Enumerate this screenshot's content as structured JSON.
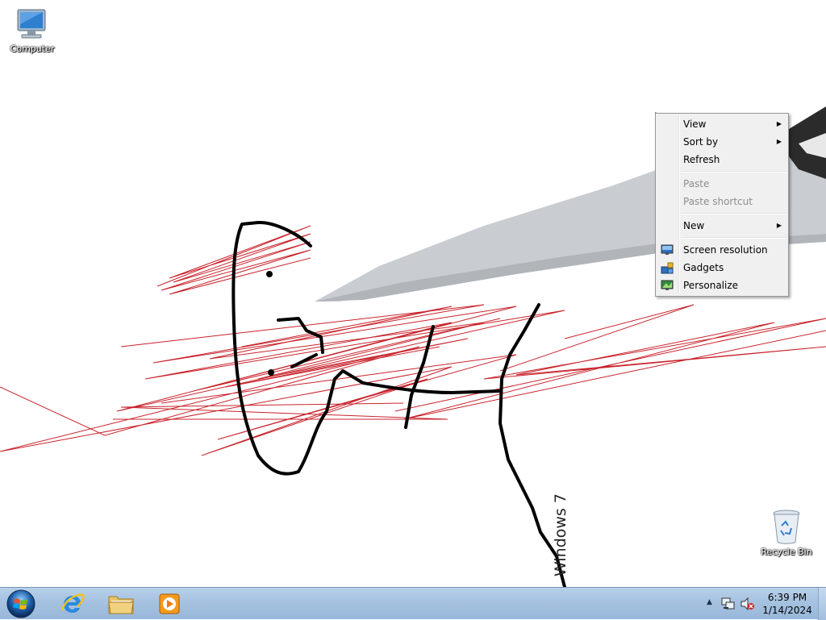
{
  "desktop": {
    "icons": [
      {
        "label": "Computer",
        "icon": "computer-icon"
      },
      {
        "label": "Recycle Bin",
        "icon": "recycle-bin-icon"
      }
    ],
    "wallpaper_text": "Windows 7"
  },
  "context_menu": {
    "items": [
      {
        "label": "View",
        "submenu": true,
        "enabled": true
      },
      {
        "label": "Sort by",
        "submenu": true,
        "enabled": true
      },
      {
        "label": "Refresh",
        "submenu": false,
        "enabled": true
      },
      {
        "label": "Paste",
        "submenu": false,
        "enabled": false
      },
      {
        "label": "Paste shortcut",
        "submenu": false,
        "enabled": false
      },
      {
        "label": "New",
        "submenu": true,
        "enabled": true
      },
      {
        "label": "Screen resolution",
        "icon": "screen-resolution-icon",
        "enabled": true
      },
      {
        "label": "Gadgets",
        "icon": "gadgets-icon",
        "enabled": true
      },
      {
        "label": "Personalize",
        "icon": "personalize-icon",
        "enabled": true
      }
    ],
    "submenu_arrow": "▶"
  },
  "taskbar": {
    "pinned": [
      {
        "icon": "start-orb-icon"
      },
      {
        "icon": "internet-explorer-icon"
      },
      {
        "icon": "file-explorer-icon"
      },
      {
        "icon": "media-player-icon"
      }
    ],
    "tray": {
      "overflow_arrow": "▲",
      "time": "6:39 PM",
      "date": "1/14/2024"
    }
  },
  "colors": {
    "taskbar": "#a7c3e1",
    "menu_bg": "#f0f0f0",
    "scribble_red": "#c8232c"
  }
}
